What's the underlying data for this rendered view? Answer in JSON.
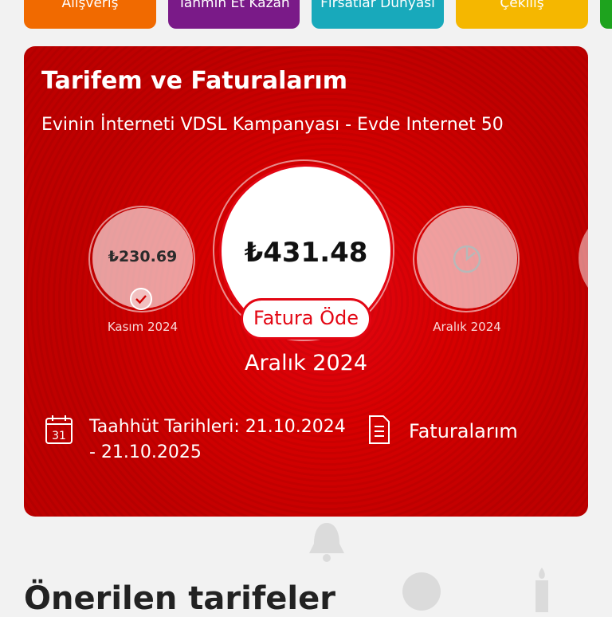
{
  "categories": [
    {
      "label": "Alışveriş",
      "color": "#f16a00"
    },
    {
      "label": "Tahmin Et Kazan",
      "color": "#7a1a88"
    },
    {
      "label": "Fırsatlar Dünyası",
      "color": "#18a9bb"
    },
    {
      "label": "Çekiliş",
      "color": "#f5b700"
    },
    {
      "label": "",
      "color": "#1ea31e"
    }
  ],
  "card": {
    "title": "Tarifem ve Faturalarım",
    "subtitle": "Evinin İnterneti VDSL Kampanyası - Evde Internet 50",
    "bills": {
      "previous": {
        "amount": "₺230.69",
        "month": "Kasım 2024",
        "status": "paid"
      },
      "current": {
        "amount": "₺431.48",
        "month": "Aralık 2024",
        "pay_label": "Fatura Öde"
      },
      "next": {
        "month": "Aralık 2024",
        "status": "pending"
      }
    },
    "commitment_text": "Taahhüt Tarihleri: 21.10.2024 - 21.10.2025",
    "calendar_day": "31",
    "invoices_link": "Faturalarım"
  },
  "section_title": "Önerilen tarifeler",
  "colors": {
    "brand_red": "#e30613",
    "card_red": "#c80000",
    "background": "#f2f2f2"
  }
}
